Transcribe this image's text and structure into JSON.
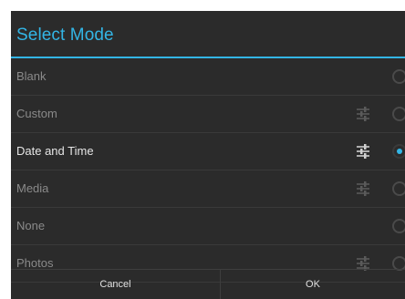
{
  "dialog": {
    "title": "Select Mode",
    "accent_color": "#33b5e5",
    "items": [
      {
        "label": "Blank",
        "has_settings": false,
        "selected": false
      },
      {
        "label": "Custom",
        "has_settings": true,
        "selected": false
      },
      {
        "label": "Date and Time",
        "has_settings": true,
        "selected": true
      },
      {
        "label": "Media",
        "has_settings": true,
        "selected": false
      },
      {
        "label": "None",
        "has_settings": false,
        "selected": false
      },
      {
        "label": "Photos",
        "has_settings": true,
        "selected": false
      }
    ],
    "buttons": {
      "cancel_label": "Cancel",
      "ok_label": "OK"
    }
  }
}
